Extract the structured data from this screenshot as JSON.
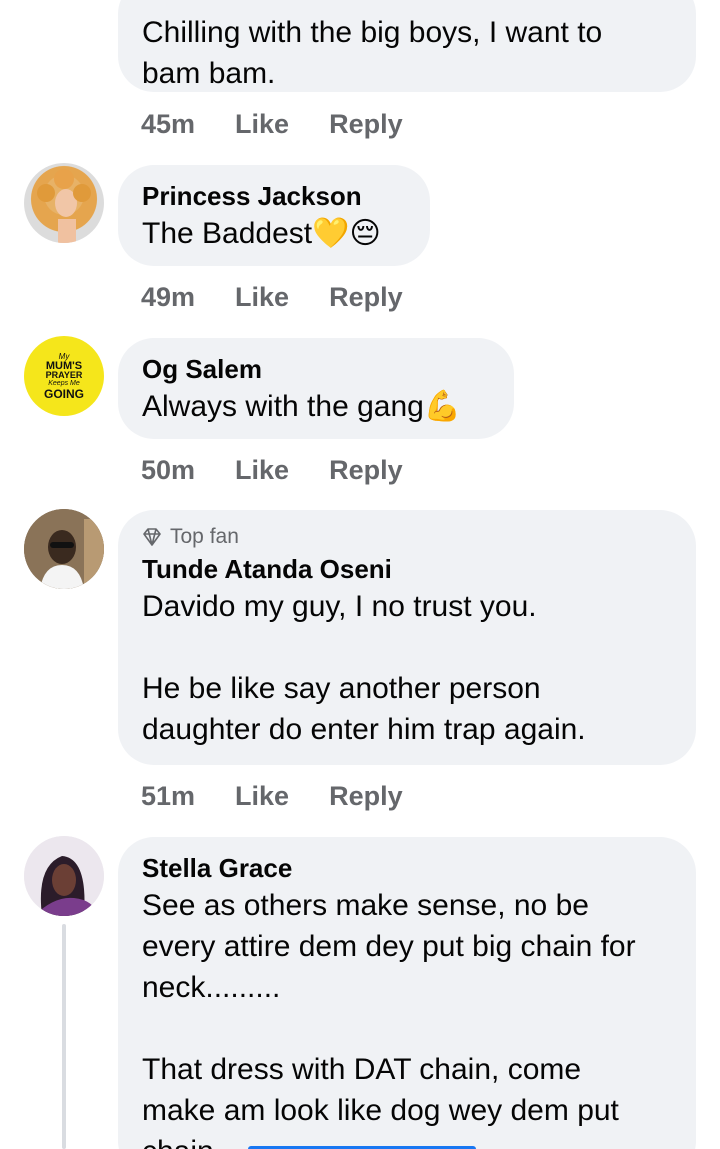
{
  "comments": [
    {
      "text": "Chilling with the big boys, I want to\nbam bam.",
      "time": "45m",
      "like": "Like",
      "reply": "Reply"
    },
    {
      "name": "Princess Jackson",
      "text": "The Baddest💛😔",
      "time": "49m",
      "like": "Like",
      "reply": "Reply"
    },
    {
      "name": "Og Salem",
      "text": "Always with the gang💪",
      "time": "50m",
      "like": "Like",
      "reply": "Reply",
      "avatar_text": [
        "My",
        "MUM'S",
        "PRAYER",
        "Keeps Me",
        "GOING"
      ]
    },
    {
      "badge": "Top fan",
      "name": "Tunde Atanda Oseni",
      "text": "Davido my guy, I no trust you.\n\nHe be like say another person\ndaughter do enter him trap again.",
      "time": "51m",
      "like": "Like",
      "reply": "Reply"
    },
    {
      "name": "Stella Grace",
      "text": "See as others make sense, no be\nevery attire dem dey put big chain for\nneck.........\n\nThat dress with DAT chain, come\nmake am look like dog wey dem put\nchain"
    }
  ],
  "colors": {
    "bubble": "#f0f2f5",
    "meta": "#65676b",
    "accent": "#1877f2",
    "avatar_yellow": "#f5e61b"
  },
  "icons": {
    "badge": "diamond-icon"
  }
}
